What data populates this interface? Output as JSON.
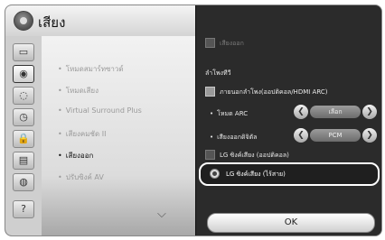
{
  "header": {
    "title": "เสียง",
    "icon": "sound-disc-icon"
  },
  "icon_column": [
    {
      "icon": "picture-icon",
      "glyph": "▭"
    },
    {
      "icon": "sound-icon",
      "glyph": "◉",
      "selected": true
    },
    {
      "icon": "disc-icon",
      "glyph": "◌"
    },
    {
      "icon": "clock-icon",
      "glyph": "◷"
    },
    {
      "icon": "lock-icon",
      "glyph": "🔒"
    },
    {
      "icon": "options-icon",
      "glyph": "▤"
    },
    {
      "icon": "network-icon",
      "glyph": "◍"
    },
    {
      "icon": "support-icon",
      "glyph": "?"
    }
  ],
  "list": {
    "items": [
      {
        "label": "โหมดสมาร์ทซาวด์",
        "active": false
      },
      {
        "label": "โหมดเสียง",
        "active": false
      },
      {
        "label": "Virtual Surround Plus",
        "active": false
      },
      {
        "label": "เสียงคมชัด II",
        "active": false
      },
      {
        "label": "เสียงออก",
        "active": true
      },
      {
        "label": "ปรับซิงค์ AV",
        "active": false
      }
    ],
    "scroll_glyph": "⌵"
  },
  "panel": {
    "top_checkbox_label": "เสียงออก",
    "section_label": "ลำโพงทีวี",
    "external_speaker_label": "ภายนอกลำโพง(ออปติคอล/HDMI ARC)",
    "arc_mode": {
      "label": "โหมด ARC",
      "value": "เลือก"
    },
    "digital_out": {
      "label": "เสียงออกดิจิตัล",
      "value": "PCM"
    },
    "lg_optical_label": "LG ซิงค์เสียง (ออปติคอล)",
    "lg_wireless_label": "LG ซิงค์เสียง (ไร้สาย)",
    "arrow_left": "❮",
    "arrow_right": "❯",
    "bullet": "•"
  },
  "ok_button": "OK"
}
